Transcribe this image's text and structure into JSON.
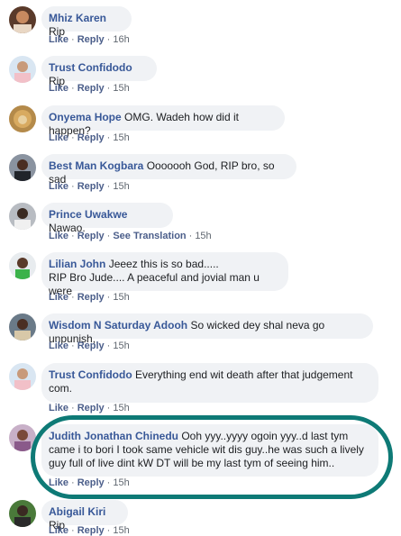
{
  "colors": {
    "name": "#385898",
    "bubble": "#f0f2f5",
    "meta": "#606770",
    "highlight": "#0e7a76"
  },
  "actions": {
    "like": "Like",
    "reply": "Reply",
    "see_translation": "See Translation",
    "dot": "·"
  },
  "comments": [
    {
      "name": "Mhiz Karen",
      "text": "Rip",
      "time": "16h"
    },
    {
      "name": "Trust Confidodo",
      "text": "Rip",
      "time": "15h"
    },
    {
      "name": "Onyema Hope",
      "text": "OMG. Wadeh how did it happen?",
      "time": "15h"
    },
    {
      "name": "Best Man Kogbara",
      "text": "Ooooooh God, RIP bro, so sad",
      "time": "15h"
    },
    {
      "name": "Prince Uwakwe",
      "text": "Nawao.",
      "time": "15h"
    },
    {
      "name": "Lilian John",
      "text": "Jeeez this is so bad.....",
      "text2": "RIP Bro Jude.... A peaceful and jovial man u were",
      "time": "15h"
    },
    {
      "name": "Wisdom N Saturday Adooh",
      "text": "So wicked dey shal neva go unpunish,",
      "time": "15h"
    },
    {
      "name": "Trust Confidodo",
      "text": "Everything end wit death after that judgement com.",
      "time": "15h"
    },
    {
      "name": "Judith Jonathan Chinedu",
      "text": "Ooh yyy..yyyy ogoin yyy..d last tym came i to bori I took same vehicle wit dis guy..he was such a lively guy full of live dint kW DT will be my last tym of seeing him..",
      "time": "15h"
    },
    {
      "name": "Abigail Kiri",
      "text": "Rip",
      "time": "15h"
    }
  ]
}
